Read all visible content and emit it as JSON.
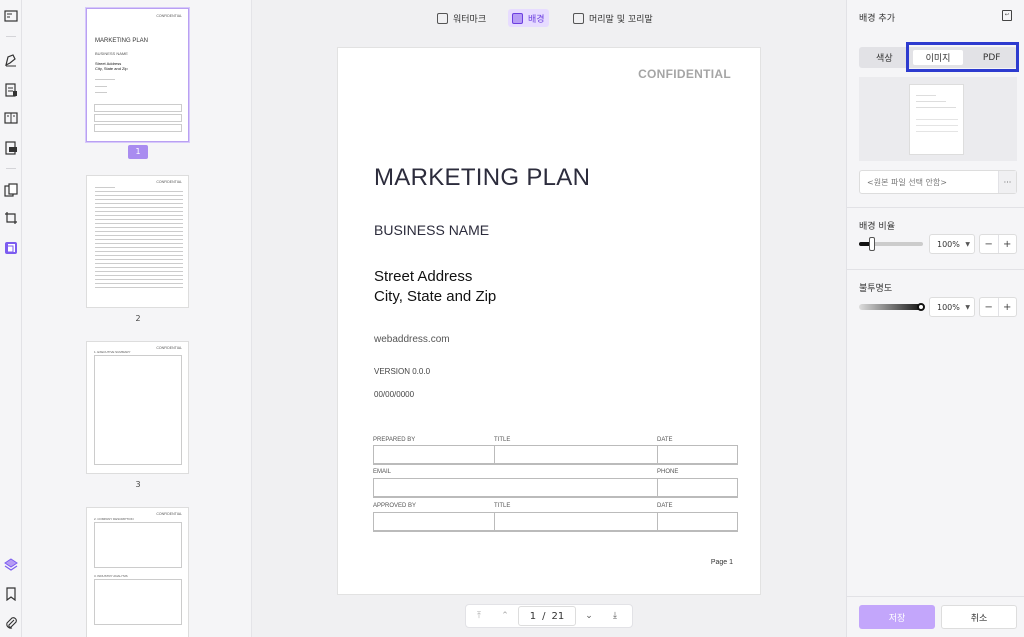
{
  "toolbar": {
    "items": [
      "view-icon",
      "edit-text-icon",
      "annotate-icon",
      "page-layout-icon",
      "form-icon",
      "organize-pages-icon",
      "crop-icon",
      "page-tools-icon",
      "layers-icon",
      "bookmark-icon",
      "attachment-icon"
    ]
  },
  "thumbnails": {
    "pages": [
      "1",
      "2",
      "3"
    ],
    "page1": {
      "confidential": "CONFIDENTIAL",
      "title": "MARKETING PLAN",
      "business": "BUSINESS NAME",
      "address1": "Street Address",
      "address2": "City, State and Zip"
    },
    "page3_header": "1. EXECUTIVE SUMMARY",
    "page4_header1": "2. COMPANY DESCRIPTION",
    "page4_header2": "3. INDUSTRY ANALYSIS",
    "page_confidential": "CONFIDENTIAL"
  },
  "topbar": {
    "tabs": [
      {
        "label": "워터마크",
        "icon": "watermark-icon"
      },
      {
        "label": "배경",
        "icon": "background-icon",
        "active": true
      },
      {
        "label": "머리말 및 꼬리말",
        "icon": "header-footer-icon"
      }
    ]
  },
  "document": {
    "confidential": "CONFIDENTIAL",
    "title": "MARKETING PLAN",
    "business_name": "BUSINESS NAME",
    "address_line1": "Street Address",
    "address_line2": "City, State and Zip",
    "web": "webaddress.com",
    "version": "VERSION 0.0.0",
    "date": "00/00/0000",
    "form": {
      "prepared_by": "PREPARED BY",
      "title": "TITLE",
      "date": "DATE",
      "email": "EMAIL",
      "phone": "PHONE",
      "approved_by": "APPROVED BY"
    },
    "page_label": "Page 1"
  },
  "navigator": {
    "current": "1",
    "separator": "/",
    "total": "21"
  },
  "panel": {
    "title": "배경 추가",
    "segments": [
      "색상",
      "이미지",
      "PDF"
    ],
    "selected_segment": "이미지",
    "file_placeholder": "<원본 파일 선택 안함>",
    "more": "···",
    "scale_label": "배경 비율",
    "scale_value": "100%",
    "scale_level": 0.2,
    "opacity_label": "불투명도",
    "opacity_value": "100%",
    "opacity_level": 1.0,
    "stepper_minus": "−",
    "stepper_plus": "+",
    "save": "저장",
    "cancel": "취소",
    "accent": "#c3a6fb",
    "highlight_color": "#2d3bcf"
  }
}
